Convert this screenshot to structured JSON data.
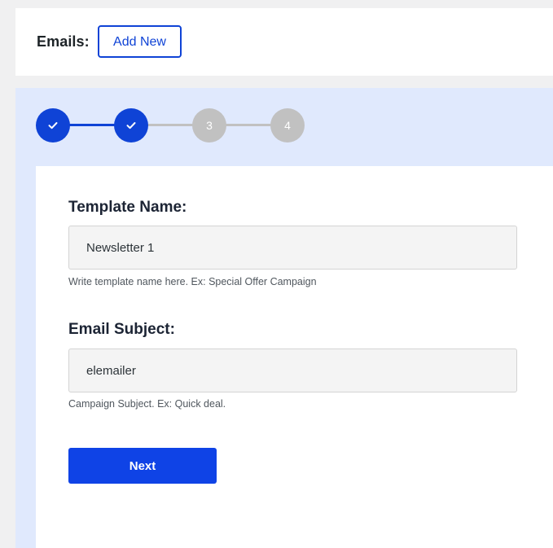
{
  "header": {
    "title": "Emails:",
    "add_new_label": "Add New",
    "accent_color": "#0f43d6"
  },
  "wizard": {
    "steps": [
      {
        "label": "",
        "status": "done",
        "icon": "check-icon"
      },
      {
        "label": "",
        "status": "done",
        "icon": "check-icon"
      },
      {
        "label": "3",
        "status": "pending"
      },
      {
        "label": "4",
        "status": "pending"
      }
    ],
    "colors": {
      "done": "#0f43d6",
      "pending": "#c1c1c1",
      "panel": "#e0e9fd"
    }
  },
  "form": {
    "template_name": {
      "label": "Template Name:",
      "value": "Newsletter 1",
      "help": "Write template name here. Ex: Special Offer Campaign"
    },
    "email_subject": {
      "label": "Email Subject:",
      "value": "elemailer",
      "help": "Campaign Subject. Ex: Quick deal."
    },
    "next_label": "Next"
  }
}
